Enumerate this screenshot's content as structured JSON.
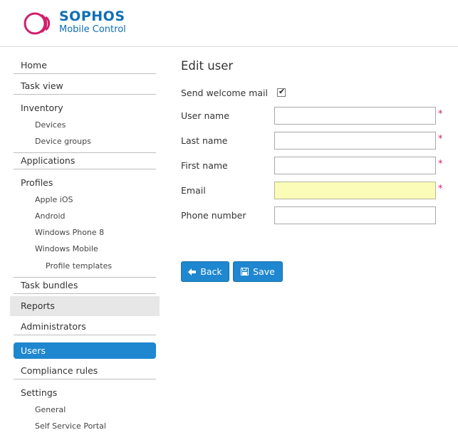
{
  "header": {
    "brand": "SOPHOS",
    "product": "Mobile Control"
  },
  "sidebar": {
    "home": "Home",
    "task_view": "Task view",
    "inventory": "Inventory",
    "devices": "Devices",
    "device_groups": "Device groups",
    "applications": "Applications",
    "profiles": "Profiles",
    "apple_ios": "Apple iOS",
    "android": "Android",
    "windows_phone_8": "Windows Phone 8",
    "windows_mobile": "Windows Mobile",
    "profile_templates": "Profile templates",
    "task_bundles": "Task bundles",
    "reports": "Reports",
    "administrators": "Administrators",
    "users": "Users",
    "compliance_rules": "Compliance rules",
    "settings": "Settings",
    "general": "General",
    "self_service_portal": "Self Service Portal"
  },
  "form": {
    "title": "Edit user",
    "send_welcome_label": "Send welcome mail",
    "send_welcome_checked": true,
    "user_name_label": "User name",
    "last_name_label": "Last name",
    "first_name_label": "First name",
    "email_label": "Email",
    "phone_label": "Phone number",
    "required_mark": "*",
    "user_name_value": "",
    "last_name_value": "",
    "first_name_value": "",
    "email_value": "",
    "phone_value": ""
  },
  "buttons": {
    "back": "Back",
    "save": "Save"
  },
  "colors": {
    "accent": "#1f87cf",
    "brand": "#0e6fb7",
    "logo_pink": "#d01f6c",
    "required": "#d01f6c",
    "highlight_field": "#fbfcb7"
  }
}
